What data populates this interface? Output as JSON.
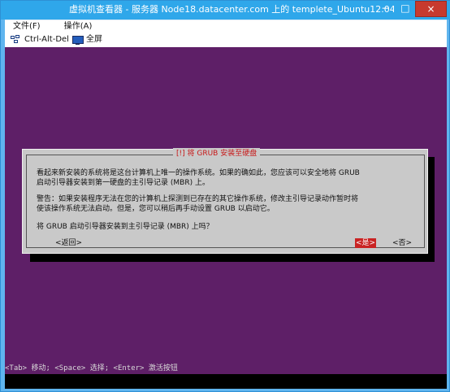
{
  "window": {
    "title": "虚拟机查看器 - 服务器 Node18.datacenter.com 上的 templete_Ubuntu12.04",
    "minimize_symbol": "−",
    "maximize_symbol": "□",
    "close_symbol": "×"
  },
  "menu": {
    "items": [
      {
        "label": "文件(F)"
      },
      {
        "label": "操作(A)"
      }
    ]
  },
  "toolbar": {
    "ctrl_alt_del_label": "Ctrl-Alt-Del",
    "fullscreen_label": "全屏",
    "icons": [
      "keyboard-icon",
      "monitor-icon"
    ]
  },
  "dialog": {
    "title": "[!] 将 GRUB 安装至硬盘",
    "paragraph_1": "看起来新安装的系统将是这台计算机上唯一的操作系统。如果的确如此，您应该可以安全地将 GRUB\n启动引导器安装到第一硬盘的主引导记录 (MBR) 上。",
    "paragraph_2": "警告：如果安装程序无法在您的计算机上探测到已存在的其它操作系统，修改主引导记录动作暂时将\n使该操作系统无法启动。但是，您可以稍后再手动设置 GRUB 以启动它。",
    "question": "将 GRUB 启动引导器安装到主引导记录 (MBR) 上吗？",
    "back_label": "<返回>",
    "yes_label": "<是>",
    "no_label": "<否>"
  },
  "console": {
    "help_text": "<Tab> 移动; <Space> 选择; <Enter> 激活按钮"
  },
  "colors": {
    "console_background": "#5e1f67",
    "dialog_background": "#c9c9c9",
    "title_red": "#c71818",
    "selected_button": "#c92323",
    "window_blue": "#2fa7ea"
  }
}
